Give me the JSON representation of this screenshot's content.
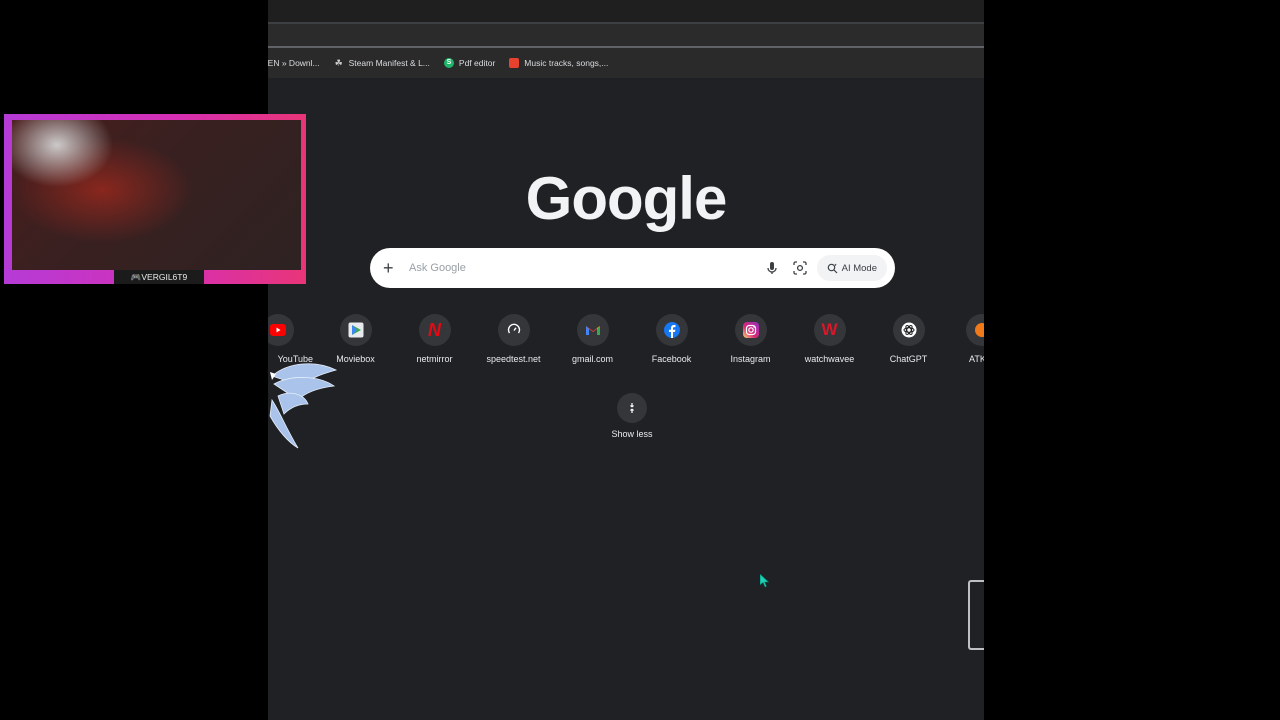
{
  "bookmarks": [
    {
      "label": "YEN » Downl...",
      "icon": "page-icon",
      "color": "#9aa0a6"
    },
    {
      "label": "Steam Manifest & L...",
      "icon": "steam-icon",
      "color": "#cfcfcf"
    },
    {
      "label": "Pdf editor",
      "icon": "pdf-editor-icon",
      "color": "#1fb56a"
    },
    {
      "label": "Music tracks, songs,...",
      "icon": "soundcloud-icon",
      "color": "#e8422f"
    }
  ],
  "logo": "Google",
  "search": {
    "placeholder": "Ask Google",
    "ai_mode_label": "AI Mode"
  },
  "shortcuts": [
    {
      "label": "YouTube",
      "icon": "youtube-icon",
      "color": "#ff0000"
    },
    {
      "label": "Moviebox",
      "icon": "play-store-icon",
      "color": "#34a853"
    },
    {
      "label": "netmirror",
      "icon": "netmirror-icon",
      "color": "#e50914"
    },
    {
      "label": "speedtest.net",
      "icon": "speedtest-icon",
      "color": "#ffffff"
    },
    {
      "label": "gmail.com",
      "icon": "gmail-icon",
      "color": "#ea4335"
    },
    {
      "label": "Facebook",
      "icon": "facebook-icon",
      "color": "#1877f2"
    },
    {
      "label": "Instagram",
      "icon": "instagram-icon",
      "color": "#e1306c"
    },
    {
      "label": "watchwavee",
      "icon": "watchwavee-icon",
      "color": "#d6182a"
    },
    {
      "label": "ChatGPT",
      "icon": "chatgpt-icon",
      "color": "#ffffff"
    },
    {
      "label": "ATK",
      "icon": "atk-icon",
      "color": "#f07a1a"
    }
  ],
  "show_less": "Show less",
  "webcam": {
    "username": "🎮VERGIL6T9"
  }
}
